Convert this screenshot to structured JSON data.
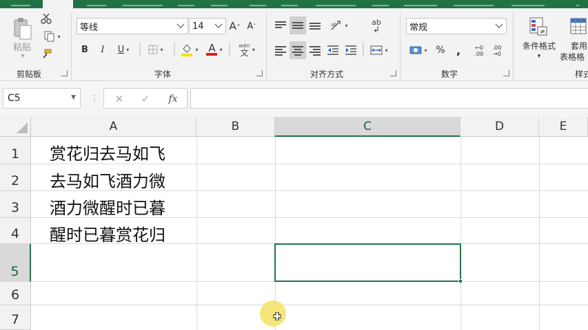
{
  "ribbon": {
    "clipboard": {
      "paste_label": "粘贴",
      "group_label": "剪贴板"
    },
    "font": {
      "font_name": "等线",
      "font_size": "14",
      "grow_label": "A",
      "shrink_label": "A",
      "bold_label": "B",
      "italic_label": "I",
      "underline_label": "U",
      "font_color_label": "A",
      "phonetic_label": "wén",
      "group_label": "字体",
      "highlight_color": "#f2e600",
      "font_color": "#e01b1b"
    },
    "alignment": {
      "wrap_label": "ab",
      "group_label": "对齐方式"
    },
    "number": {
      "format_value": "常规",
      "percent_label": "%",
      "comma_label": ",",
      "inc_decimal_label": ".00",
      "dec_decimal_label": ".00",
      "group_label": "数字"
    },
    "styles": {
      "conditional_format_label": "条件格式",
      "table_format_label_line1": "套用",
      "table_format_label_line2": "表格格",
      "group_label": "样式"
    }
  },
  "formula_bar": {
    "name_box": "C5",
    "cancel_label": "✕",
    "enter_label": "✓",
    "fx_label": "fx",
    "formula": ""
  },
  "sheet": {
    "columns": [
      "A",
      "B",
      "C",
      "D",
      "E"
    ],
    "rows": [
      "1",
      "2",
      "3",
      "4",
      "5",
      "6",
      "7"
    ],
    "selected_cell": "C5",
    "cells": {
      "A1": "赏花归去马如飞",
      "A2": "去马如飞酒力微",
      "A3": "酒力微醒时已暮",
      "A4": "醒时已暮赏花归"
    }
  },
  "colors": {
    "accent": "#217346",
    "ribbon_bg": "#f3f3f3",
    "cursor_halo": "#f3e36a"
  }
}
